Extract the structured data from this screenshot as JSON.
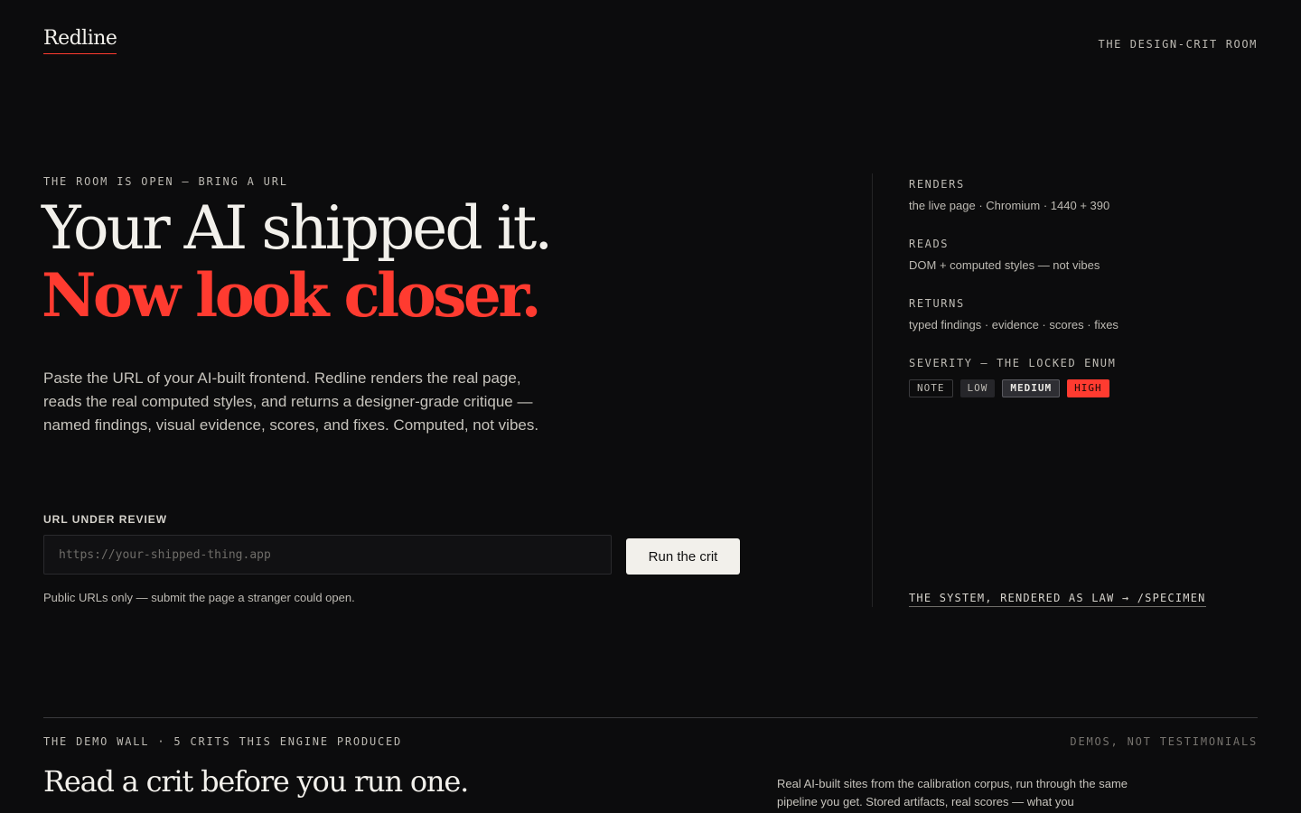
{
  "header": {
    "brand": "Redline",
    "tagline": "THE DESIGN-CRIT ROOM"
  },
  "hero": {
    "eyebrow": "THE ROOM IS OPEN — BRING A URL",
    "headline_line1": "Your AI shipped it.",
    "headline_line2": "Now look closer.",
    "lede": "Paste the URL of your AI-built frontend. Redline renders the real page, reads the real computed styles, and returns a designer-grade critique — named findings, visual evidence, scores, and fixes. Computed, not vibes."
  },
  "form": {
    "label": "URL UNDER REVIEW",
    "placeholder": "https://your-shipped-thing.app",
    "value": "",
    "submit_label": "Run the crit",
    "hint": "Public URLs only — submit the page a stranger could open."
  },
  "spec": {
    "renders": {
      "label": "RENDERS",
      "value": "the live page · Chromium · 1440 + 390"
    },
    "reads": {
      "label": "READS",
      "value": "DOM + computed styles — not vibes"
    },
    "returns": {
      "label": "RETURNS",
      "value": "typed findings · evidence · scores · fixes"
    },
    "severity": {
      "label": "SEVERITY — THE LOCKED ENUM",
      "levels": [
        "NOTE",
        "LOW",
        "MEDIUM",
        "HIGH"
      ]
    },
    "specimen_link": "THE SYSTEM, RENDERED AS LAW → /SPECIMEN"
  },
  "demo_wall": {
    "eyebrow": "THE DEMO WALL · 5 CRITS THIS ENGINE PRODUCED",
    "aside": "DEMOS, NOT TESTIMONIALS",
    "title": "Read a crit before you run one.",
    "description": "Real AI-built sites from the calibration corpus, run through the same pipeline you get. Stored artifacts, real scores — what you"
  },
  "colors": {
    "background": "#0c0c0d",
    "accent": "#ff3b30",
    "text": "#f2f0eb",
    "muted": "#bdbab3"
  }
}
